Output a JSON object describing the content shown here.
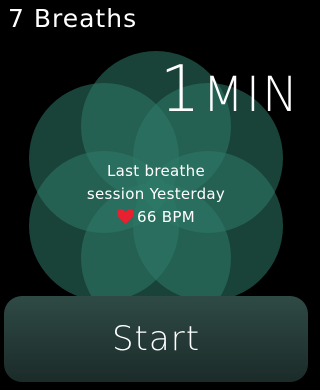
{
  "app": {
    "title": "7 Breaths"
  },
  "duration": {
    "value": "1",
    "unit": "MIN"
  },
  "last_session": {
    "line1": "Last breathe",
    "line2": "session Yesterday",
    "heart_icon": "heart-icon",
    "heart_rate": "66 BPM"
  },
  "start_button": {
    "label": "Start"
  },
  "colors": {
    "background": "#000000",
    "petal": "#2e7a68",
    "heart": "#e8202f",
    "button": "#263c38"
  }
}
